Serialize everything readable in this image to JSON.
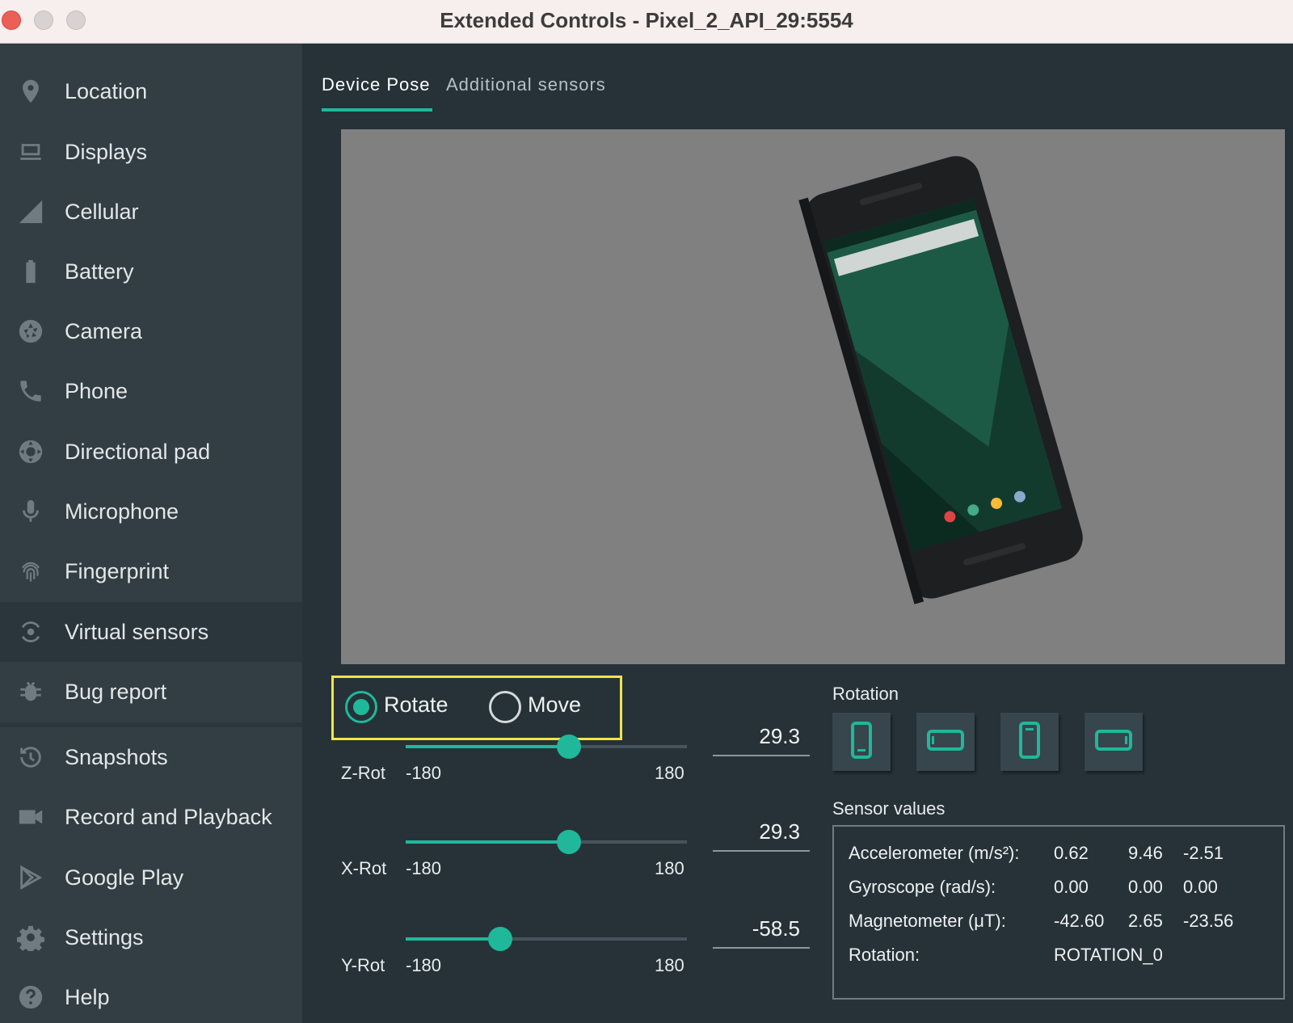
{
  "window": {
    "title": "Extended Controls - Pixel_2_API_29:5554"
  },
  "sidebar": {
    "items": [
      {
        "id": "location",
        "label": "Location",
        "icon": "location-pin-icon"
      },
      {
        "id": "displays",
        "label": "Displays",
        "icon": "monitor-icon"
      },
      {
        "id": "cellular",
        "label": "Cellular",
        "icon": "cellular-signal-icon"
      },
      {
        "id": "battery",
        "label": "Battery",
        "icon": "battery-icon"
      },
      {
        "id": "camera",
        "label": "Camera",
        "icon": "camera-aperture-icon"
      },
      {
        "id": "phone",
        "label": "Phone",
        "icon": "phone-handset-icon"
      },
      {
        "id": "dpad",
        "label": "Directional pad",
        "icon": "dpad-icon"
      },
      {
        "id": "microphone",
        "label": "Microphone",
        "icon": "microphone-icon"
      },
      {
        "id": "fingerprint",
        "label": "Fingerprint",
        "icon": "fingerprint-icon"
      },
      {
        "id": "virtual-sensors",
        "label": "Virtual sensors",
        "icon": "virtual-sensors-icon",
        "active": true
      },
      {
        "id": "bug-report",
        "label": "Bug report",
        "icon": "bug-icon"
      },
      {
        "id": "snapshots",
        "label": "Snapshots",
        "icon": "history-icon"
      },
      {
        "id": "record-playback",
        "label": "Record and Playback",
        "icon": "video-camera-icon"
      },
      {
        "id": "google-play",
        "label": "Google Play",
        "icon": "play-store-icon"
      },
      {
        "id": "settings",
        "label": "Settings",
        "icon": "gear-icon"
      },
      {
        "id": "help",
        "label": "Help",
        "icon": "help-icon"
      }
    ]
  },
  "tabs": [
    {
      "label": "Device Pose",
      "active": true
    },
    {
      "label": "Additional sensors",
      "active": false
    }
  ],
  "mode": {
    "rotate_label": "Rotate",
    "move_label": "Move",
    "selected": "rotate"
  },
  "sliders": [
    {
      "name": "Z-Rot",
      "min_label": "-180",
      "max_label": "180",
      "min": -180,
      "max": 180,
      "value": 29.3,
      "value_text": "29.3"
    },
    {
      "name": "X-Rot",
      "min_label": "-180",
      "max_label": "180",
      "min": -180,
      "max": 180,
      "value": 29.3,
      "value_text": "29.3"
    },
    {
      "name": "Y-Rot",
      "min_label": "-180",
      "max_label": "180",
      "min": -180,
      "max": 180,
      "value": -58.5,
      "value_text": "-58.5"
    }
  ],
  "rotation": {
    "title": "Rotation",
    "buttons": [
      {
        "id": "portrait",
        "icon": "portrait-phone-icon"
      },
      {
        "id": "landscape",
        "icon": "landscape-phone-icon"
      },
      {
        "id": "reverse-portrait",
        "icon": "reverse-portrait-phone-icon"
      },
      {
        "id": "reverse-landscape",
        "icon": "reverse-landscape-phone-icon"
      }
    ]
  },
  "sensor_values": {
    "title": "Sensor values",
    "rows": [
      {
        "label": "Accelerometer (m/s²):",
        "v1": "0.62",
        "v2": "9.46",
        "v3": "-2.51"
      },
      {
        "label": "Gyroscope (rad/s):",
        "v1": "0.00",
        "v2": "0.00",
        "v3": "0.00"
      },
      {
        "label": "Magnetometer (μT):",
        "v1": "-42.60",
        "v2": "2.65",
        "v3": "-23.56"
      },
      {
        "label": "Rotation:",
        "v1": "ROTATION_0",
        "v2": "",
        "v3": ""
      }
    ]
  },
  "colors": {
    "accent": "#1fb89a",
    "sidebar_bg": "#323d44",
    "main_bg": "#263238",
    "viewport_bg": "#808080",
    "highlight_box": "#f1e54a"
  }
}
